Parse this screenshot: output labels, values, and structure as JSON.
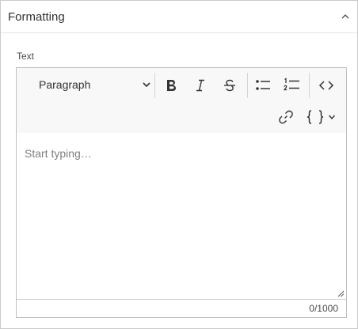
{
  "panel": {
    "title": "Formatting"
  },
  "field": {
    "label": "Text"
  },
  "toolbar": {
    "paragraph_select": {
      "selected": "Paragraph"
    },
    "buttons": [
      "bold",
      "italic",
      "strikethrough",
      "bulleted-list",
      "numbered-list",
      "code",
      "link",
      "insert-field"
    ]
  },
  "editor": {
    "placeholder": "Start typing…",
    "char_count": "0/1000"
  },
  "colors": {
    "border": "#cacaca",
    "toolbar_bg": "#f8f8f8",
    "text": "#323232",
    "placeholder": "#7e7e7e"
  }
}
